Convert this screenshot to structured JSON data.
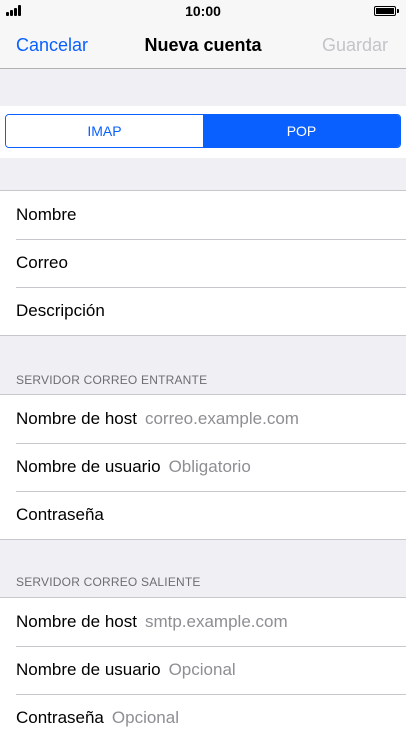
{
  "status": {
    "time": "10:00"
  },
  "nav": {
    "cancel": "Cancelar",
    "title": "Nueva cuenta",
    "save": "Guardar"
  },
  "segment": {
    "options": [
      "IMAP",
      "POP"
    ],
    "selected": "POP"
  },
  "account": {
    "rows": [
      {
        "label": "Nombre"
      },
      {
        "label": "Correo"
      },
      {
        "label": "Descripción"
      }
    ]
  },
  "incoming": {
    "header": "SERVIDOR CORREO ENTRANTE",
    "rows": [
      {
        "label": "Nombre de host",
        "value": "correo.example.com"
      },
      {
        "label": "Nombre de usuario",
        "value": "Obligatorio"
      },
      {
        "label": "Contraseña",
        "value": ""
      }
    ]
  },
  "outgoing": {
    "header": "SERVIDOR CORREO SALIENTE",
    "rows": [
      {
        "label": "Nombre de host",
        "value": "smtp.example.com"
      },
      {
        "label": "Nombre de usuario",
        "value": "Opcional"
      },
      {
        "label": "Contraseña",
        "value": "Opcional"
      }
    ]
  }
}
